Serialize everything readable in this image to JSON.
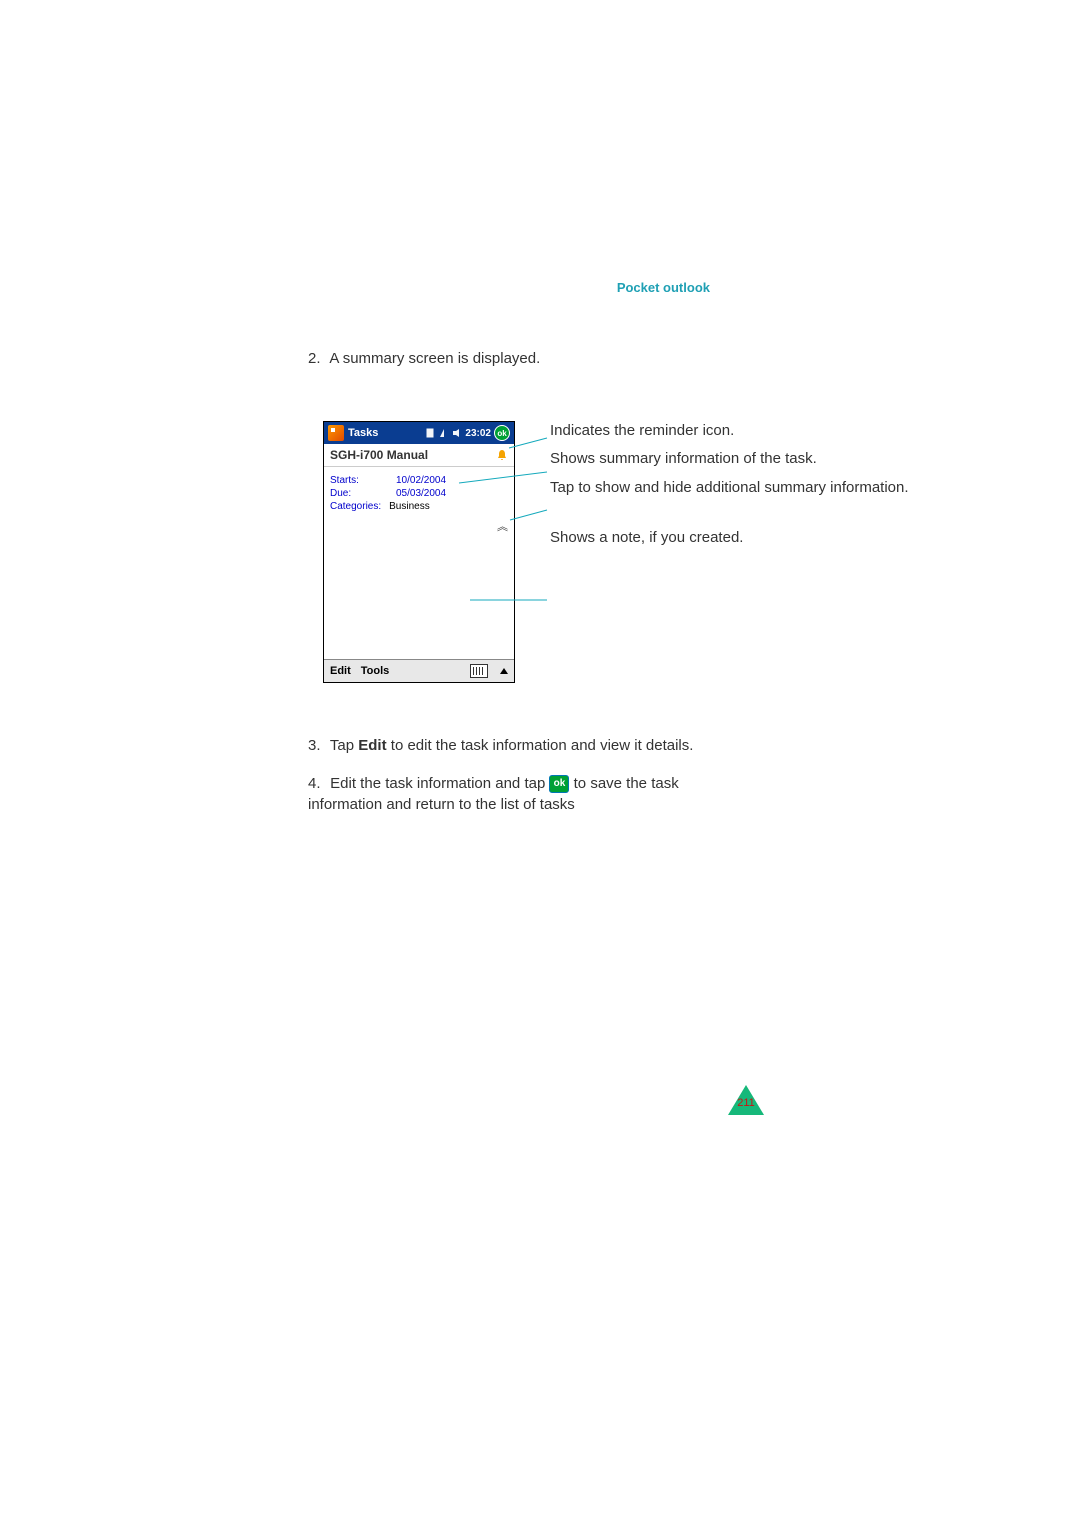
{
  "header": {
    "section": "Pocket outlook"
  },
  "steps": {
    "s2": {
      "num": "2.",
      "text": "A summary screen is displayed."
    },
    "s3": {
      "num": "3.",
      "pre": "Tap ",
      "bold": "Edit",
      "post": " to edit the task information and view it details."
    },
    "s4": {
      "num": "4.",
      "pre": "Edit the task information and tap ",
      "post": " to save the task information and return to the list of tasks"
    }
  },
  "screenshot": {
    "titlebar": {
      "app": "Tasks",
      "time": "23:02",
      "ok": "ok"
    },
    "task_title": "SGH-i700 Manual",
    "rows": {
      "starts": {
        "label": "Starts:",
        "value": "10/02/2004"
      },
      "due": {
        "label": "Due:",
        "value": "05/03/2004"
      },
      "cat": {
        "label": "Categories:",
        "value": "Business"
      }
    },
    "footer": {
      "edit": "Edit",
      "tools": "Tools"
    }
  },
  "callouts": {
    "c1": "Indicates the reminder icon.",
    "c2": "Shows summary information of the task.",
    "c3": "Tap to show and hide additional summary information.",
    "c4": "Shows a note, if you created."
  },
  "inline_ok": "ok",
  "page_number": "211"
}
